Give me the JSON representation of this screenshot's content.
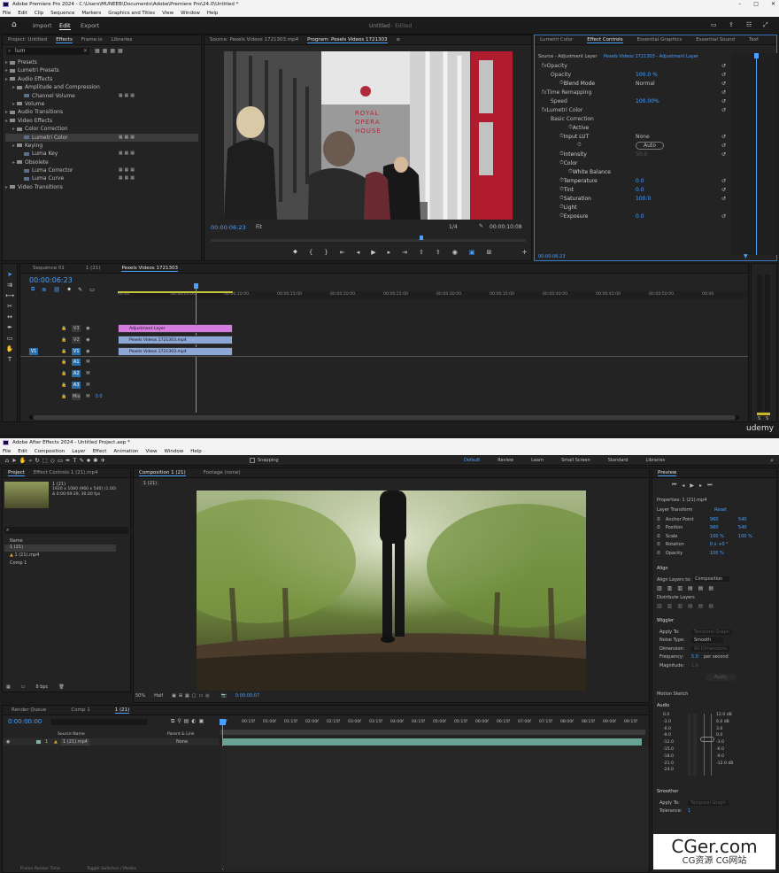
{
  "premiere": {
    "title": "Adobe Premiere Pro 2024 - C:\\Users\\MUNEEB\\Documents\\Adobe\\Premiere Pro\\24.0\\Untitled *",
    "menu": [
      "File",
      "Edit",
      "Clip",
      "Sequence",
      "Markers",
      "Graphics and Titles",
      "View",
      "Window",
      "Help"
    ],
    "nav": {
      "import": "Import",
      "edit": "Edit",
      "export": "Export"
    },
    "doc_title": "Untitled",
    "doc_status": "- Edited",
    "left_tabs": [
      "Project: Untitled",
      "Effects",
      "Frame.io",
      "Libraries"
    ],
    "search_value": "lum",
    "effects_tree": [
      {
        "label": "Presets",
        "level": 0
      },
      {
        "label": "Lumetri Presets",
        "level": 0
      },
      {
        "label": "Audio Effects",
        "level": 0
      },
      {
        "label": "Amplitude and Compression",
        "level": 1
      },
      {
        "label": "Channel Volume",
        "level": 2
      },
      {
        "label": "Volume",
        "level": 1
      },
      {
        "label": "Audio Transitions",
        "level": 0
      },
      {
        "label": "Video Effects",
        "level": 0
      },
      {
        "label": "Color Correction",
        "level": 1
      },
      {
        "label": "Lumetri Color",
        "level": 2
      },
      {
        "label": "Keying",
        "level": 1
      },
      {
        "label": "Luma Key",
        "level": 2
      },
      {
        "label": "Obsolete",
        "level": 1
      },
      {
        "label": "Luma Corrector",
        "level": 2
      },
      {
        "label": "Luma Curve",
        "level": 2
      },
      {
        "label": "Video Transitions",
        "level": 0
      }
    ],
    "monitor_tabs": [
      "Source: Pexels Videos 1721303.mp4",
      "Program: Pexels Videos 1721303"
    ],
    "program": {
      "timecode": "00:00:06:23",
      "fit": "Fit",
      "res": "1/4",
      "duration": "00:00:10:08",
      "sign_l1": "ROYAL",
      "sign_l2": "OPERA",
      "sign_l3": "HOUSE"
    },
    "right_tabs": [
      "Lumetri Color",
      "Effect Controls",
      "Essential Graphics",
      "Essential Sound",
      "Text"
    ],
    "ec_source": "Source - Adjustment Layer",
    "ec_target": "Pexels Videos 1721303 - Adjustment Layer",
    "ec_rows": [
      {
        "label": "Opacity",
        "val": "",
        "lvl": 0,
        "fx": true
      },
      {
        "label": "Opacity",
        "val": "100.0 %",
        "lvl": 1
      },
      {
        "label": "Blend Mode",
        "val": "Normal",
        "lvl": 2
      },
      {
        "label": "Time Remapping",
        "val": "",
        "lvl": 0,
        "fx": true
      },
      {
        "label": "Speed",
        "val": "100.00%",
        "lvl": 1
      },
      {
        "label": "Lumetri Color",
        "val": "",
        "lvl": 0,
        "fx": true
      },
      {
        "label": "Basic Correction",
        "val": "",
        "lvl": 1
      },
      {
        "label": "Active",
        "val": "",
        "lvl": 3
      },
      {
        "label": "Input LUT",
        "val": "None",
        "lvl": 2
      },
      {
        "label": "",
        "val": "Auto",
        "lvl": 4
      },
      {
        "label": "Intensity",
        "val": "50.0",
        "lvl": 2,
        "dim": true
      },
      {
        "label": "Color",
        "val": "",
        "lvl": 2
      },
      {
        "label": "White Balance",
        "val": "",
        "lvl": 3
      },
      {
        "label": "Temperature",
        "val": "0.0",
        "lvl": 2
      },
      {
        "label": "Tint",
        "val": "0.0",
        "lvl": 2
      },
      {
        "label": "Saturation",
        "val": "100.0",
        "lvl": 2
      },
      {
        "label": "Light",
        "val": "",
        "lvl": 2
      },
      {
        "label": "Exposure",
        "val": "0.0",
        "lvl": 2
      }
    ],
    "ec_timecode": "00:00:06:23",
    "seq_tabs": [
      "Sequence 01",
      "1 (21)",
      "Pexels Videos 1721303"
    ],
    "seq_timecode": "00:00:06:23",
    "ruler": [
      "00:00",
      "00:00:05:00",
      "00:00:10:00",
      "00:00:15:00",
      "00:00:20:00",
      "00:00:25:00",
      "00:00:30:00",
      "00:00:35:00",
      "00:00:40:00",
      "00:00:45:00",
      "00:00:50:00",
      "00:00"
    ],
    "tracks": [
      {
        "name": "V3"
      },
      {
        "name": "V2"
      },
      {
        "name": "V1",
        "src": "V1"
      },
      {
        "name": "A1"
      },
      {
        "name": "A2"
      },
      {
        "name": "A3"
      },
      {
        "name": "Mix",
        "val": "0.0"
      }
    ],
    "clips": [
      {
        "label": "Adjustment Layer",
        "track": 0
      },
      {
        "label": "Pexels Videos 1721303.mp4",
        "track": 1
      },
      {
        "label": "Pexels Videos 1721303.mp4",
        "track": 2
      }
    ],
    "meter_labels": [
      "S",
      "S"
    ],
    "udemy": "udemy"
  },
  "aftereffects": {
    "title": "Adobe After Effects 2024 - Untitled Project.aep *",
    "menu": [
      "File",
      "Edit",
      "Composition",
      "Layer",
      "Effect",
      "Animation",
      "View",
      "Window",
      "Help"
    ],
    "snapping": "Snapping",
    "workspaces": [
      "Default",
      "Review",
      "Learn",
      "Small Screen",
      "Standard",
      "Libraries"
    ],
    "project_tab": "Project",
    "ec_tab": "Effect Controls 1 (21).mp4",
    "item_name": "1 (21)",
    "item_line1": "1920 x 1080 (960 x 540) (1.00)",
    "item_line2": "Δ 0:00:09:29, 30.00 fps",
    "col_name": "Name",
    "items": [
      "1 (21)",
      "1 (21).mp4",
      "Comp 1"
    ],
    "comp_tab": "Composition 1 (21)",
    "footage_tab": "Footage (none)",
    "comp_sub": "1 (21)",
    "zoom": "50%",
    "quality": "Half",
    "comp_time": "0:00:00:07",
    "bpc": "8 bpc",
    "timeline_tabs": [
      "Render Queue",
      "Comp 1",
      "1 (21)"
    ],
    "timecode": "0:00:00:00",
    "tl_cols": {
      "src": "Source Name",
      "parent": "Parent & Link"
    },
    "layer": {
      "num": "1",
      "name": "1 (21).mp4",
      "parent": "None"
    },
    "ruler": [
      "00f",
      "00:15f",
      "01:00f",
      "01:15f",
      "02:00f",
      "02:15f",
      "03:00f",
      "03:15f",
      "04:00f",
      "04:15f",
      "05:00f",
      "05:15f",
      "06:00f",
      "06:15f",
      "07:00f",
      "07:15f",
      "08:00f",
      "08:15f",
      "09:00f",
      "09:15f"
    ],
    "bottom_tabs": [
      "Frame Render Time",
      "Toggle Switches / Modes"
    ],
    "preview": "Preview",
    "props_title": "Properties: 1 (21).mp4",
    "layer_transform": "Layer Transform",
    "reset": "Reset",
    "props": [
      {
        "label": "Anchor Point",
        "v1": "960",
        "v2": "540"
      },
      {
        "label": "Position",
        "v1": "960",
        "v2": "540"
      },
      {
        "label": "Scale",
        "v1": "100 %",
        "v2": "100 %"
      },
      {
        "label": "Rotation",
        "v1": "0 x +0 °",
        "v2": ""
      },
      {
        "label": "Opacity",
        "v1": "100 %",
        "v2": ""
      }
    ],
    "align": "Align",
    "align_to_label": "Align Layers to:",
    "align_to": "Composition",
    "distribute": "Distribute Layers",
    "wiggler": "Wiggler",
    "apply_to": "Apply To:",
    "apply_to_val": "Temporal Graph",
    "noise_type": "Noise Type:",
    "noise_val": "Smooth",
    "dimension": "Dimension:",
    "dimension_val": "All Dimensions",
    "frequency": "Frequency:",
    "frequency_val": "5.0",
    "per_second": "per second",
    "magnitude": "Magnitude:",
    "magnitude_val": "1.0",
    "apply": "Apply",
    "motion_sketch": "Motion Sketch",
    "audio": "Audio",
    "audio_left": [
      "0.0",
      "-3.0",
      "-6.0",
      "-9.0",
      "-12.0",
      "-15.0",
      "-18.0",
      "-21.0",
      "-24.0"
    ],
    "audio_right": [
      "12.0 dB",
      "6.0 dB",
      "3.0",
      "0.0",
      "-3.0",
      "-6.0",
      "-9.0",
      "-12.0 dB"
    ],
    "smoother": "Smoother",
    "sm_apply_to": "Apply To:",
    "sm_apply_val": "Temporal Graph",
    "tolerance": "Tolerance:",
    "tolerance_val": "1",
    "watermark": "CGer.com",
    "watermark_sub": "CG资源 CG网站"
  }
}
